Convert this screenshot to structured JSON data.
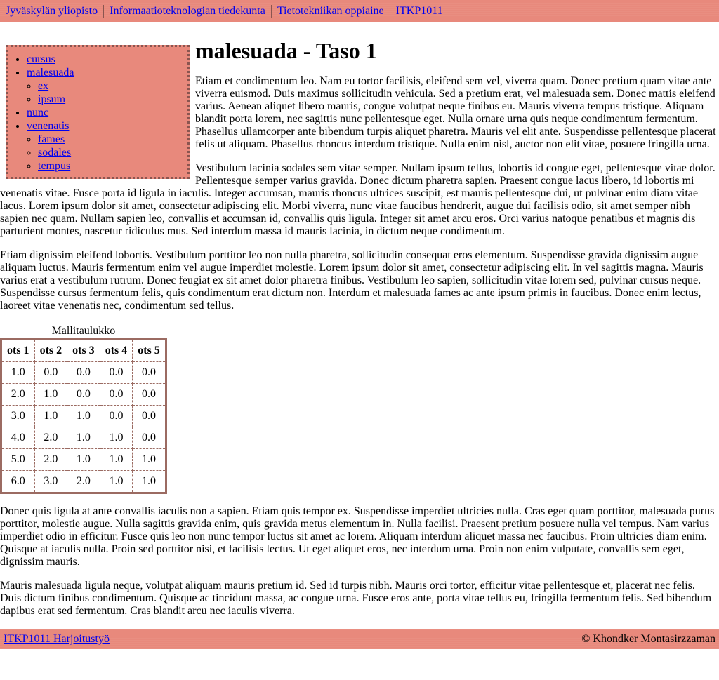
{
  "breadcrumb": [
    {
      "label": "Jyväskylän yliopisto"
    },
    {
      "label": "Informaatioteknologian tiedekunta"
    },
    {
      "label": "Tietotekniikan oppiaine"
    },
    {
      "label": "ITKP1011"
    }
  ],
  "nav": {
    "items": [
      {
        "label": "cursus"
      },
      {
        "label": "malesuada",
        "children": [
          {
            "label": "ex"
          },
          {
            "label": "ipsum"
          }
        ]
      },
      {
        "label": "nunc"
      },
      {
        "label": "venenatis",
        "children": [
          {
            "label": "fames"
          },
          {
            "label": "sodales"
          },
          {
            "label": "tempus"
          }
        ]
      }
    ]
  },
  "page_title": "malesuada - Taso 1",
  "paragraphs": [
    "Etiam et condimentum leo. Nam eu tortor facilisis, eleifend sem vel, viverra quam. Donec pretium quam vitae ante viverra euismod. Duis maximus sollicitudin vehicula. Sed a pretium erat, vel malesuada sem. Donec mattis eleifend varius. Aenean aliquet libero mauris, congue volutpat neque finibus eu. Mauris viverra tempus tristique. Aliquam blandit porta lorem, nec sagittis nunc pellentesque eget. Nulla ornare urna quis neque condimentum fermentum. Phasellus ullamcorper ante bibendum turpis aliquet pharetra. Mauris vel elit ante. Suspendisse pellentesque placerat felis ut aliquam. Phasellus rhoncus interdum tristique. Nulla enim nisl, auctor non elit vitae, posuere fringilla urna.",
    "Vestibulum lacinia sodales sem vitae semper. Nullam ipsum tellus, lobortis id congue eget, pellentesque vitae dolor. Pellentesque semper varius gravida. Donec dictum pharetra sapien. Praesent congue lacus libero, id lobortis mi venenatis vitae. Fusce porta id ligula in iaculis. Integer accumsan, mauris rhoncus ultrices suscipit, est mauris pellentesque dui, ut pulvinar enim diam vitae lacus. Lorem ipsum dolor sit amet, consectetur adipiscing elit. Morbi viverra, nunc vitae faucibus hendrerit, augue dui facilisis odio, sit amet semper nibh sapien nec quam. Nullam sapien leo, convallis et accumsan id, convallis quis ligula. Integer sit amet arcu eros. Orci varius natoque penatibus et magnis dis parturient montes, nascetur ridiculus mus. Sed interdum massa id mauris lacinia, in dictum neque condimentum.",
    "Etiam dignissim eleifend lobortis. Vestibulum porttitor leo non nulla pharetra, sollicitudin consequat eros elementum. Suspendisse gravida dignissim augue aliquam luctus. Mauris fermentum enim vel augue imperdiet molestie. Lorem ipsum dolor sit amet, consectetur adipiscing elit. In vel sagittis magna. Mauris varius erat a vestibulum rutrum. Donec feugiat ex sit amet dolor pharetra finibus. Vestibulum leo sapien, sollicitudin vitae lorem sed, pulvinar cursus neque. Suspendisse cursus fermentum felis, quis condimentum erat dictum non. Interdum et malesuada fames ac ante ipsum primis in faucibus. Donec enim lectus, laoreet vitae venenatis nec, condimentum sed tellus."
  ],
  "table": {
    "caption": "Mallitaulukko",
    "headers": [
      "ots 1",
      "ots 2",
      "ots 3",
      "ots 4",
      "ots 5"
    ],
    "rows": [
      [
        "1.0",
        "0.0",
        "0.0",
        "0.0",
        "0.0"
      ],
      [
        "2.0",
        "1.0",
        "0.0",
        "0.0",
        "0.0"
      ],
      [
        "3.0",
        "1.0",
        "1.0",
        "0.0",
        "0.0"
      ],
      [
        "4.0",
        "2.0",
        "1.0",
        "1.0",
        "0.0"
      ],
      [
        "5.0",
        "2.0",
        "1.0",
        "1.0",
        "1.0"
      ],
      [
        "6.0",
        "3.0",
        "2.0",
        "1.0",
        "1.0"
      ]
    ]
  },
  "paragraphs_after": [
    "Donec quis ligula at ante convallis iaculis non a sapien. Etiam quis tempor ex. Suspendisse imperdiet ultricies nulla. Cras eget quam porttitor, malesuada purus porttitor, molestie augue. Nulla sagittis gravida enim, quis gravida metus elementum in. Nulla facilisi. Praesent pretium posuere nulla vel tempus. Nam varius imperdiet odio in efficitur. Fusce quis leo non nunc tempor luctus sit amet ac lorem. Aliquam interdum aliquet massa nec faucibus. Proin ultricies diam enim. Quisque at iaculis nulla. Proin sed porttitor nisi, et facilisis lectus. Ut eget aliquet eros, nec interdum urna. Proin non enim vulputate, convallis sem eget, dignissim mauris.",
    "Mauris malesuada ligula neque, volutpat aliquam mauris pretium id. Sed id turpis nibh. Mauris orci tortor, efficitur vitae pellentesque et, placerat nec felis. Duis dictum finibus condimentum. Quisque ac tincidunt massa, ac congue urna. Fusce eros ante, porta vitae tellus eu, fringilla fermentum felis. Sed bibendum dapibus erat sed fermentum. Cras blandit arcu nec iaculis viverra."
  ],
  "footer": {
    "link_label": "ITKP1011 Harjoitustyö",
    "copyright": "©  Khondker Montasirzzaman"
  },
  "colors": {
    "bar_background": "#e8897c",
    "border": "#9b6b62",
    "link": "#0000ee"
  }
}
